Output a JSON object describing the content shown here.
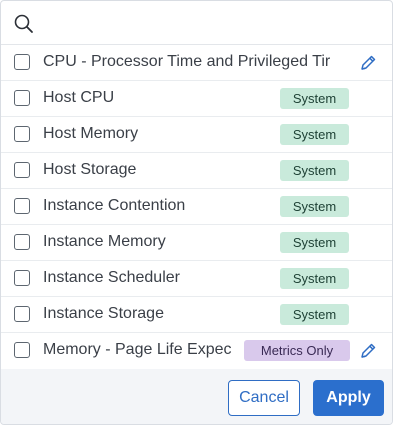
{
  "search": {
    "placeholder": "",
    "value": "",
    "icon": "search-icon"
  },
  "items": [
    {
      "label": "CPU - Processor Time and Privileged Tir",
      "badge": "",
      "editable": true
    },
    {
      "label": "Host CPU",
      "badge": "System",
      "editable": false
    },
    {
      "label": "Host Memory",
      "badge": "System",
      "editable": false
    },
    {
      "label": "Host Storage",
      "badge": "System",
      "editable": false
    },
    {
      "label": "Instance Contention",
      "badge": "System",
      "editable": false
    },
    {
      "label": "Instance Memory",
      "badge": "System",
      "editable": false
    },
    {
      "label": "Instance Scheduler",
      "badge": "System",
      "editable": false
    },
    {
      "label": "Instance Storage",
      "badge": "System",
      "editable": false
    },
    {
      "label": "Memory - Page Life Expec",
      "badge": "Metrics Only",
      "editable": true
    }
  ],
  "footer": {
    "cancel_label": "Cancel",
    "apply_label": "Apply"
  },
  "colors": {
    "system_badge_bg": "#c9eadb",
    "metrics_badge_bg": "#d9c9ec",
    "primary": "#2b6fcd",
    "footer_bg": "#f3f5f8"
  }
}
